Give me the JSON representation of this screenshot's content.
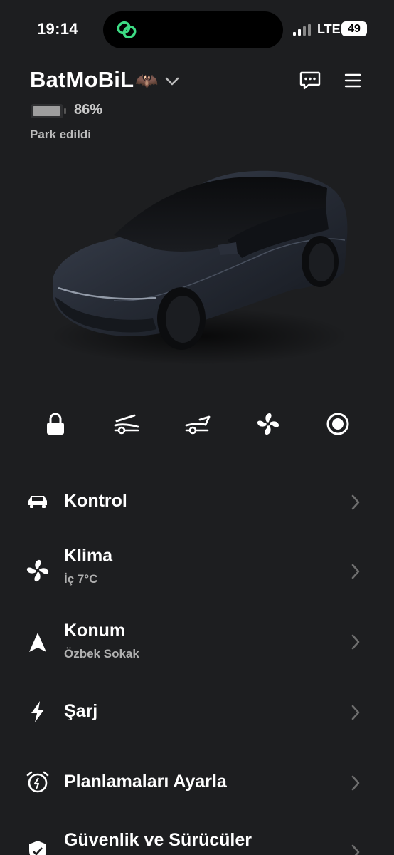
{
  "status_bar": {
    "time": "19:14",
    "network": "LTE",
    "battery": "49"
  },
  "header": {
    "car_name": "BatMoBiL",
    "car_name_emoji": "🦇",
    "battery_percent": "86%",
    "battery_level": 0.86,
    "state": "Park edildi"
  },
  "quick_actions": [
    {
      "icon": "lock-icon"
    },
    {
      "icon": "frunk-icon"
    },
    {
      "icon": "trunk-icon"
    },
    {
      "icon": "fan-icon"
    },
    {
      "icon": "record-icon"
    }
  ],
  "menu": [
    {
      "title": "Kontrol",
      "subtitle": "",
      "icon": "car-icon"
    },
    {
      "title": "Klima",
      "subtitle": "İç 7°C",
      "icon": "fan-icon"
    },
    {
      "title": "Konum",
      "subtitle": "Özbek Sokak",
      "icon": "location-arrow-icon"
    },
    {
      "title": "Şarj",
      "subtitle": "",
      "icon": "lightning-icon"
    },
    {
      "title": "Planlamaları Ayarla",
      "subtitle": "",
      "icon": "alarm-clock-icon"
    },
    {
      "title": "Güvenlik ve Sürücüler",
      "subtitle": "",
      "icon": "shield-icon"
    }
  ],
  "colors": {
    "background": "#1d1e20",
    "accent_green": "#3ddc84",
    "text_secondary": "#b0b0b0"
  }
}
